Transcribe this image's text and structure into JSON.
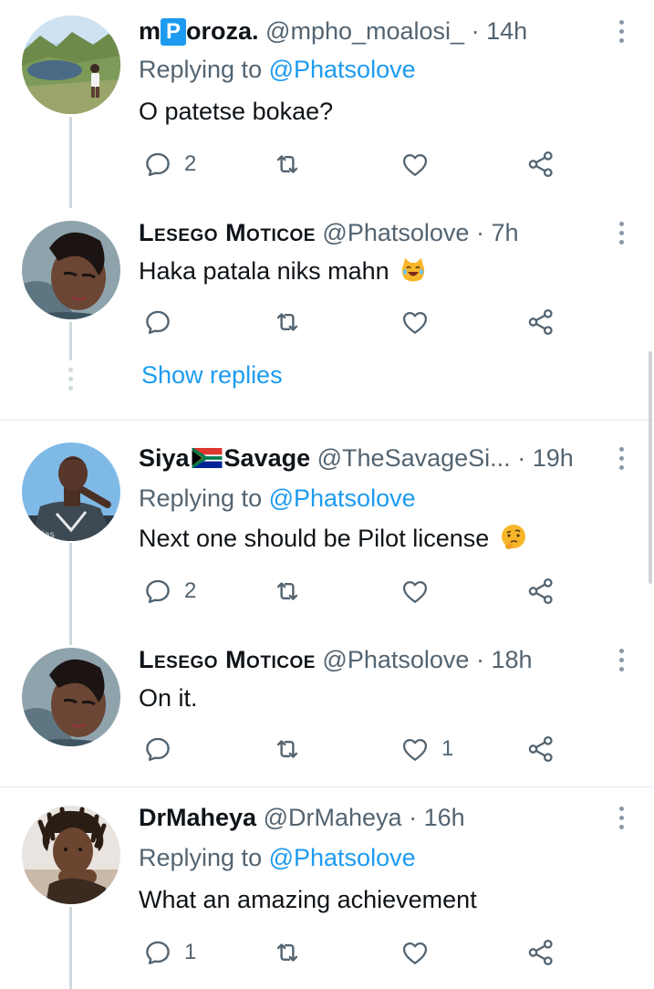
{
  "tweets": [
    {
      "name_pre": "m",
      "name_box": "P",
      "name_post": "oroza.",
      "handle": "@mpho_moalosi_",
      "dot": "·",
      "time": "14h",
      "replying_prefix": "Replying to",
      "replying_to": "@Phatsolove",
      "text": "O patetse bokae?",
      "replies": "2",
      "likes": ""
    },
    {
      "name": "Lesego Moticoe",
      "handle": "@Phatsolove",
      "dot": "·",
      "time": "7h",
      "text": "Haka patala niks mahn",
      "emoji": "laughing-cat-emoji",
      "replies": "",
      "likes": ""
    },
    {
      "show_replies": "Show replies"
    },
    {
      "name_pre": "Siya",
      "name_post": "Savage",
      "flag": "south-africa-flag",
      "handle": "@TheSavageSi...",
      "dot": "·",
      "time": "19h",
      "replying_prefix": "Replying to",
      "replying_to": "@Phatsolove",
      "text": "Next one should be Pilot license",
      "emoji": "thinking-face-emoji",
      "replies": "2",
      "likes": ""
    },
    {
      "name": "Lesego Moticoe",
      "handle": "@Phatsolove",
      "dot": "·",
      "time": "18h",
      "text": "On it.",
      "replies": "",
      "likes": "1"
    },
    {
      "name": "DrMaheya",
      "handle": "@DrMaheya",
      "dot": "·",
      "time": "16h",
      "replying_prefix": "Replying to",
      "replying_to": "@Phatsolove",
      "text": "What an amazing achievement",
      "replies": "1",
      "likes": ""
    }
  ],
  "colors": {
    "accent": "#1d9bf0",
    "secondary_text": "#536471",
    "icon": "#536471",
    "divider": "#e1e8ed"
  }
}
